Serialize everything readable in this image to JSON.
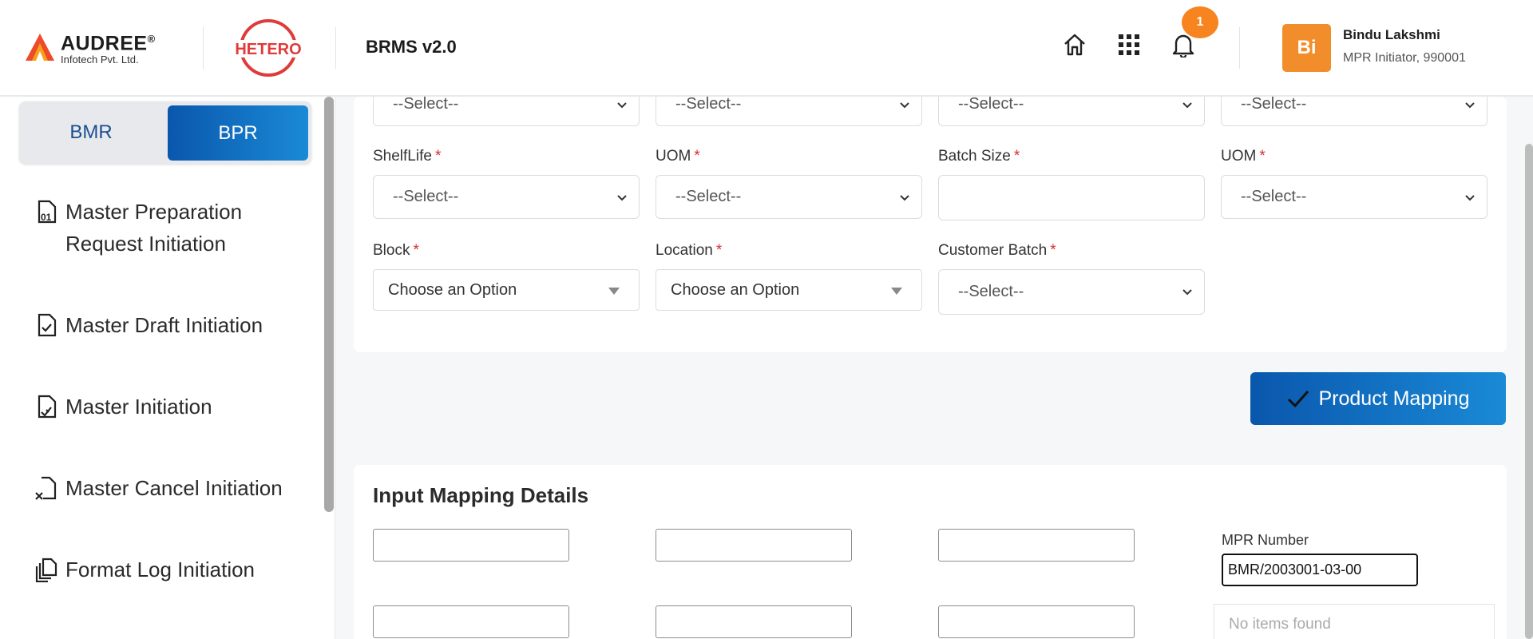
{
  "header": {
    "company_name": "AUDREE",
    "company_reg": "®",
    "company_sub": "Infotech Pvt. Ltd.",
    "client_logo_text": "HETERO",
    "app_title": "BRMS v2.0",
    "notification_count": "1",
    "user": {
      "initials": "Bi",
      "name": "Bindu Lakshmi",
      "role": "MPR Initiator, 990001"
    },
    "icons": [
      "home-icon",
      "apps-grid-icon",
      "bell-icon"
    ]
  },
  "sidebar": {
    "toggle": {
      "left": "BMR",
      "right": "BPR",
      "active": "BPR"
    },
    "items": [
      {
        "label": "Master Preparation Request Initiation",
        "icon": "document-01-icon"
      },
      {
        "label": "Master Draft Initiation",
        "icon": "document-check-icon"
      },
      {
        "label": "Master Initiation",
        "icon": "document-sign-icon"
      },
      {
        "label": "Master Cancel Initiation",
        "icon": "document-cancel-icon"
      },
      {
        "label": "Format Log Initiation",
        "icon": "copy-documents-icon"
      }
    ]
  },
  "form": {
    "top_row_values": [
      "--Select--",
      "--Select--",
      "--Select--",
      "--Select--"
    ],
    "shelflife": {
      "label": "ShelfLife",
      "value": "--Select--"
    },
    "uom1": {
      "label": "UOM",
      "value": "--Select--"
    },
    "batch_size": {
      "label": "Batch Size",
      "value": ""
    },
    "uom2": {
      "label": "UOM",
      "value": "--Select--"
    },
    "block": {
      "label": "Block",
      "value": "Choose an Option"
    },
    "location": {
      "label": "Location",
      "value": "Choose an Option"
    },
    "customer_batch": {
      "label": "Customer Batch",
      "value": "--Select--"
    },
    "required_mark": "*"
  },
  "actions": {
    "product_mapping": "Product Mapping"
  },
  "input_mapping": {
    "title": "Input Mapping Details",
    "mpr_label": "MPR Number",
    "mpr_value": "BMR/2003001-03-00",
    "no_items": "No items found"
  },
  "colors": {
    "primary": "#0a57ad",
    "primary_light": "#1a8ad6",
    "accent_orange": "#f7841e",
    "required": "#d32f2f"
  }
}
